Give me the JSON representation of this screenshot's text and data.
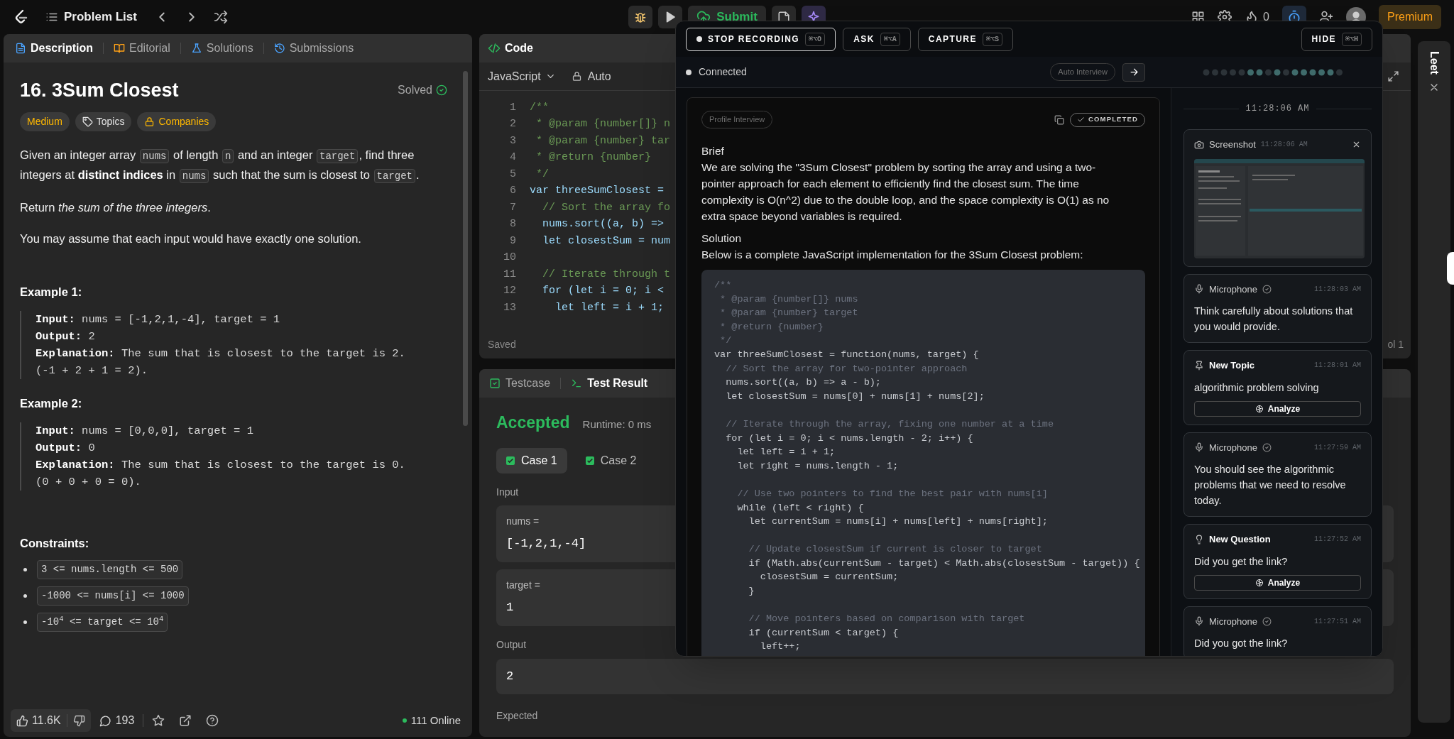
{
  "top_bar": {
    "problem_list": "Problem List",
    "submit": "Submit",
    "streak": "0",
    "premium": "Premium"
  },
  "description_panel": {
    "tabs": [
      {
        "label": "Description",
        "kind": "description",
        "selected": true
      },
      {
        "label": "Editorial",
        "kind": "editorial",
        "selected": false
      },
      {
        "label": "Solutions",
        "kind": "solutions",
        "selected": false
      },
      {
        "label": "Submissions",
        "kind": "submissions",
        "selected": false
      }
    ],
    "title": "16. 3Sum Closest",
    "status": "Solved",
    "tags": [
      {
        "label": "Medium",
        "kind": "difficulty"
      },
      {
        "label": "Topics",
        "kind": "topics"
      },
      {
        "label": "Companies",
        "kind": "companies"
      }
    ],
    "statement": [
      {
        "kind": "text",
        "text": "Given an integer array "
      },
      {
        "kind": "code",
        "text": "nums"
      },
      {
        "kind": "text",
        "text": " of length "
      },
      {
        "kind": "code",
        "text": "n"
      },
      {
        "kind": "text",
        "text": " and an integer "
      },
      {
        "kind": "code",
        "text": "target"
      },
      {
        "kind": "text",
        "text": ", find three integers at "
      },
      {
        "kind": "bold",
        "text": "distinct indices"
      },
      {
        "kind": "text",
        "text": " in "
      },
      {
        "kind": "code",
        "text": "nums"
      },
      {
        "kind": "text",
        "text": " such that the sum is closest to "
      },
      {
        "kind": "code",
        "text": "target"
      },
      {
        "kind": "text",
        "text": "."
      }
    ],
    "paragraphs": [
      "Return *the sum of the three integers*.",
      "You may assume that each input would have exactly one solution."
    ],
    "examples": [
      {
        "heading": "Example 1:",
        "lines": [
          "**Input:** nums = [-1,2,1,-4], target = 1",
          "**Output:** 2",
          "**Explanation:** The sum that is closest to the target is 2.",
          "(-1 + 2 + 1 = 2)."
        ]
      },
      {
        "heading": "Example 2:",
        "lines": [
          "**Input:** nums = [0,0,0], target = 1",
          "**Output:** 0",
          "**Explanation:** The sum that is closest to the target is 0.",
          "(0 + 0 + 0 = 0)."
        ]
      }
    ],
    "constraints_heading": "Constraints:",
    "constraints": [
      "3 <= nums.length <= 500",
      "-1000 <= nums[i] <= 1000",
      "-10$^{4}$ <= target <= 10$^{4}$"
    ],
    "footer": {
      "likes": "11.6K",
      "comments": "193",
      "online": "111 Online"
    }
  },
  "code_panel": {
    "title": "Code",
    "language": "JavaScript",
    "mode": "Auto",
    "lines": [
      {
        "no": "1",
        "kind": "comment",
        "text": "/**"
      },
      {
        "no": "2",
        "kind": "comment",
        "text": " * @param {number[]} n"
      },
      {
        "no": "3",
        "kind": "comment",
        "text": " * @param {number} tar"
      },
      {
        "no": "4",
        "kind": "comment",
        "text": " * @return {number}"
      },
      {
        "no": "5",
        "kind": "comment",
        "text": " */"
      },
      {
        "no": "6",
        "kind": "code",
        "text": "var threeSumClosest ="
      },
      {
        "no": "7",
        "kind": "comment",
        "text": "  // Sort the array fo"
      },
      {
        "no": "8",
        "kind": "code",
        "text": "  nums.sort((a, b) =>"
      },
      {
        "no": "9",
        "kind": "code",
        "text": "  let closestSum = num"
      },
      {
        "no": "10",
        "kind": "blank"
      },
      {
        "no": "11",
        "kind": "comment",
        "text": "  // Iterate through t"
      },
      {
        "no": "12",
        "kind": "code",
        "text": "  for (let i = 0; i <"
      },
      {
        "no": "13",
        "kind": "code",
        "text": "    let left = i + 1;"
      }
    ],
    "status": "Saved",
    "cursor": "ol 1"
  },
  "test_panel": {
    "tabs": [
      {
        "label": "Testcase",
        "kind": "testcase",
        "selected": false
      },
      {
        "label": "Test Result",
        "kind": "result",
        "selected": true
      }
    ],
    "verdict": "Accepted",
    "runtime": "Runtime: 0 ms",
    "cases": [
      {
        "label": "Case 1",
        "selected": true
      },
      {
        "label": "Case 2",
        "selected": false
      }
    ],
    "input_label": "Input",
    "inputs": [
      {
        "name": "nums =",
        "value": "[-1,2,1,-4]"
      },
      {
        "name": "target =",
        "value": "1"
      }
    ],
    "output_label": "Output",
    "output": "2",
    "expected_label": "Expected"
  },
  "assistant_overlay": {
    "actions": [
      {
        "label": "STOP RECORDING",
        "shortcut": "⌘⌥O",
        "kind": "record"
      },
      {
        "label": "ASK",
        "shortcut": "⌘⌥A",
        "kind": "plain"
      },
      {
        "label": "CAPTURE",
        "shortcut": "⌘⌥S",
        "kind": "plain"
      }
    ],
    "hide": {
      "label": "HIDE",
      "shortcut": "⌘⌥H"
    },
    "connection": "Connected",
    "mode_chip": "Auto Interview",
    "response": {
      "profile_chip": "Profile Interview",
      "status": "COMPLETED",
      "sections": [
        {
          "heading": "Brief",
          "body": "We are solving the \"3Sum Closest\" problem by sorting the array and using a two-pointer approach for each element to efficiently find the closest sum. The time complexity is O(n^2) due to the double loop, and the space complexity is O(1) as no extra space beyond variables is required."
        },
        {
          "heading": "Solution",
          "body": "Below is a complete JavaScript implementation for the 3Sum Closest problem:"
        }
      ],
      "code": [
        {
          "kind": "comment",
          "text": "/**"
        },
        {
          "kind": "comment",
          "text": " * @param {number[]} nums"
        },
        {
          "kind": "comment",
          "text": " * @param {number} target"
        },
        {
          "kind": "comment",
          "text": " * @return {number}"
        },
        {
          "kind": "comment",
          "text": " */"
        },
        {
          "kind": "code",
          "text": "var threeSumClosest = function(nums, target) {"
        },
        {
          "kind": "comment",
          "text": "  // Sort the array for two-pointer approach"
        },
        {
          "kind": "code",
          "text": "  nums.sort((a, b) => a - b);"
        },
        {
          "kind": "code",
          "text": "  let closestSum = nums[0] + nums[1] + nums[2];"
        },
        {
          "kind": "blank"
        },
        {
          "kind": "comment",
          "text": "  // Iterate through the array, fixing one number at a time"
        },
        {
          "kind": "code",
          "text": "  for (let i = 0; i < nums.length - 2; i++) {"
        },
        {
          "kind": "code",
          "text": "    let left = i + 1;"
        },
        {
          "kind": "code",
          "text": "    let right = nums.length - 1;"
        },
        {
          "kind": "blank"
        },
        {
          "kind": "comment",
          "text": "    // Use two pointers to find the best pair with nums[i]"
        },
        {
          "kind": "code",
          "text": "    while (left < right) {"
        },
        {
          "kind": "code",
          "text": "      let currentSum = nums[i] + nums[left] + nums[right];"
        },
        {
          "kind": "blank"
        },
        {
          "kind": "comment",
          "text": "      // Update closestSum if current is closer to target"
        },
        {
          "kind": "code",
          "text": "      if (Math.abs(currentSum - target) < Math.abs(closestSum - target)) {"
        },
        {
          "kind": "code",
          "text": "        closestSum = currentSum;"
        },
        {
          "kind": "code",
          "text": "      }"
        },
        {
          "kind": "blank"
        },
        {
          "kind": "comment",
          "text": "      // Move pointers based on comparison with target"
        },
        {
          "kind": "code",
          "text": "      if (currentSum < target) {"
        },
        {
          "kind": "code",
          "text": "        left++;"
        }
      ]
    },
    "timeline": {
      "time": "11:28:06 AM",
      "events": [
        {
          "kind": "screenshot",
          "title": "Screenshot",
          "time": "11:28:06 AM"
        },
        {
          "kind": "microphone",
          "title": "Microphone",
          "time": "11:28:03 AM",
          "text": "Think carefully about solutions that you would provide."
        },
        {
          "kind": "topic",
          "title": "New Topic",
          "time": "11:28:01 AM",
          "text": "algorithmic problem solving",
          "action": "Analyze"
        },
        {
          "kind": "microphone",
          "title": "Microphone",
          "time": "11:27:59 AM",
          "text": "You should see the algorithmic problems that we need to resolve today."
        },
        {
          "kind": "question",
          "title": "New Question",
          "time": "11:27:52 AM",
          "text": "Did you get the link?",
          "action": "Analyze"
        },
        {
          "kind": "microphone",
          "title": "Microphone",
          "time": "11:27:51 AM",
          "text": "Did you got the link?"
        }
      ]
    }
  },
  "side_strip": {
    "title": "Leet"
  }
}
